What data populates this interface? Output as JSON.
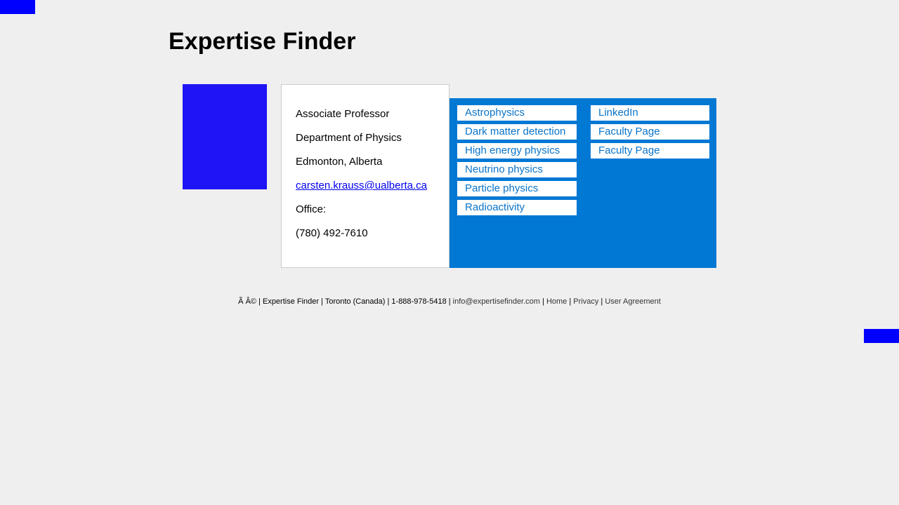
{
  "header": {
    "title": "Expertise Finder"
  },
  "profile": {
    "lines": [
      "Associate Professor",
      "Department of Physics",
      "Edmonton, Alberta"
    ],
    "email": "carsten.krauss@ualberta.ca",
    "office_label": "Office:",
    "phone": "(780) 492-7610"
  },
  "expertise": {
    "tags": [
      "Astrophysics",
      "Dark matter detection",
      "High energy physics",
      "Neutrino physics",
      "Particle physics",
      "Radioactivity"
    ]
  },
  "links": {
    "items": [
      "LinkedIn",
      "Faculty Page",
      "Faculty Page"
    ]
  },
  "footer": {
    "copyright": "Ã   Â© | Expertise Finder | Toronto (Canada) | 1-888-978-5418 | ",
    "email": "info@expertisefinder.com",
    "sep": " | ",
    "home": "Home",
    "privacy": "Privacy",
    "agreement": "User Agreement"
  },
  "colors": {
    "accent_panel": "#0078d4",
    "photo": "#1f14f5",
    "corner_blocks": "#0000ff",
    "background": "#efefef"
  }
}
